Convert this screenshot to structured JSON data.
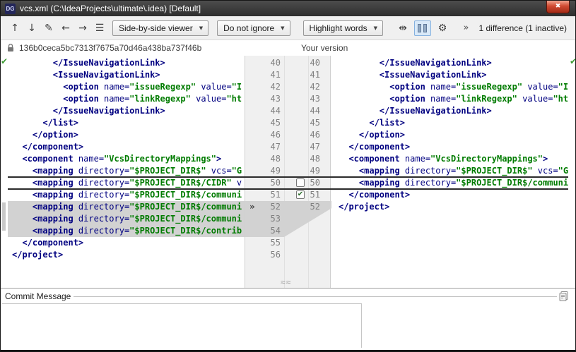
{
  "window": {
    "title": "vcs.xml (C:\\IdeaProjects\\ultimate\\.idea) [Default]",
    "app_icon_text": "DG"
  },
  "toolbar": {
    "viewer_mode": "Side-by-side viewer",
    "ignore_policy": "Do not ignore",
    "highlight_mode": "Highlight words",
    "diff_summary": "1 difference (1 inactive)"
  },
  "icons": {
    "previous": "↑",
    "next": "↓",
    "edit": "✎",
    "back": "←",
    "forward": "→",
    "menu": "☰",
    "collapse-unchanged": "⇹",
    "settings-gear": "⚙",
    "more-chevron": "»",
    "dropdown-arrow": "▼",
    "applied-check": "✔",
    "inactive-marker": "»",
    "checkbox-check": "✔",
    "close": "✖",
    "approx": "≈≈"
  },
  "header": {
    "left_revision": "136b0ceca5bc7313f7675a70d46a438ba737f46b",
    "right_label": "Your version"
  },
  "colors": {
    "tag": "#000080",
    "value": "#007b00",
    "inactive_gray": "#d2d2d2"
  },
  "commit": {
    "label": "Commit Message"
  },
  "diff": {
    "rows": [
      {
        "l": "40",
        "r": "40",
        "left": [
          [
            "t",
            "        </IssueNavigationLink>"
          ]
        ],
        "right": [
          [
            "t",
            "        </IssueNavigationLink>"
          ]
        ]
      },
      {
        "l": "41",
        "r": "41",
        "left": [
          [
            "t",
            "        <IssueNavigationLink>"
          ]
        ],
        "right": [
          [
            "t",
            "        <IssueNavigationLink>"
          ]
        ]
      },
      {
        "l": "42",
        "r": "42",
        "left": [
          [
            "t",
            "          <option "
          ],
          [
            "a",
            "name="
          ],
          [
            "v",
            "\"issueRegexp\""
          ],
          [
            "a",
            " value="
          ],
          [
            "v",
            "\"I"
          ]
        ],
        "right": [
          [
            "t",
            "          <option "
          ],
          [
            "a",
            "name="
          ],
          [
            "v",
            "\"issueRegexp\""
          ],
          [
            "a",
            " value="
          ],
          [
            "v",
            "\"IDEA"
          ]
        ]
      },
      {
        "l": "43",
        "r": "43",
        "left": [
          [
            "t",
            "          <option "
          ],
          [
            "a",
            "name="
          ],
          [
            "v",
            "\"linkRegexp\""
          ],
          [
            "a",
            " value="
          ],
          [
            "v",
            "\"ht"
          ]
        ],
        "right": [
          [
            "t",
            "          <option "
          ],
          [
            "a",
            "name="
          ],
          [
            "v",
            "\"linkRegexp\""
          ],
          [
            "a",
            " value="
          ],
          [
            "v",
            "\"https"
          ]
        ]
      },
      {
        "l": "44",
        "r": "44",
        "left": [
          [
            "t",
            "        </IssueNavigationLink>"
          ]
        ],
        "right": [
          [
            "t",
            "        </IssueNavigationLink>"
          ]
        ]
      },
      {
        "l": "45",
        "r": "45",
        "left": [
          [
            "t",
            "      </list>"
          ]
        ],
        "right": [
          [
            "t",
            "      </list>"
          ]
        ]
      },
      {
        "l": "46",
        "r": "46",
        "left": [
          [
            "t",
            "    </option>"
          ]
        ],
        "right": [
          [
            "t",
            "    </option>"
          ]
        ]
      },
      {
        "l": "47",
        "r": "47",
        "left": [
          [
            "t",
            "  </component>"
          ]
        ],
        "right": [
          [
            "t",
            "  </component>"
          ]
        ]
      },
      {
        "l": "48",
        "r": "48",
        "left": [
          [
            "t",
            "  <component "
          ],
          [
            "a",
            "name="
          ],
          [
            "v",
            "\"VcsDirectoryMappings\""
          ],
          [
            "t",
            ">"
          ]
        ],
        "right": [
          [
            "t",
            "  <component "
          ],
          [
            "a",
            "name="
          ],
          [
            "v",
            "\"VcsDirectoryMappings\""
          ],
          [
            "t",
            ">"
          ]
        ]
      },
      {
        "l": "49",
        "r": "49",
        "left": [
          [
            "t",
            "    <mapping "
          ],
          [
            "a",
            "directory="
          ],
          [
            "v",
            "\"$PROJECT_DIR$\""
          ],
          [
            "a",
            " vcs="
          ],
          [
            "v",
            "\"G"
          ]
        ],
        "right": [
          [
            "t",
            "    <mapping "
          ],
          [
            "a",
            "directory="
          ],
          [
            "v",
            "\"$PROJECT_DIR$\""
          ],
          [
            "a",
            " vcs="
          ],
          [
            "v",
            "\"Git\""
          ]
        ]
      },
      {
        "l": "50",
        "r": "50",
        "left": [
          [
            "t",
            "    <mapping "
          ],
          [
            "a",
            "directory="
          ],
          [
            "v",
            "\"$PROJECT_DIR$/CIDR\""
          ],
          [
            "a",
            " v"
          ]
        ],
        "right": [
          [
            "t",
            "    <mapping "
          ],
          [
            "a",
            "directory="
          ],
          [
            "v",
            "\"$PROJECT_DIR$/community\""
          ]
        ]
      },
      {
        "l": "51",
        "r": "51",
        "left": [
          [
            "t",
            "    <mapping "
          ],
          [
            "a",
            "directory="
          ],
          [
            "v",
            "\"$PROJECT_DIR$/communi"
          ]
        ],
        "right": [
          [
            "t",
            "  </component>"
          ]
        ]
      },
      {
        "l": "52",
        "r": "52",
        "gray": true,
        "left": [
          [
            "t",
            "    <mapping "
          ],
          [
            "a",
            "directory="
          ],
          [
            "v",
            "\"$PROJECT_DIR$/communi"
          ]
        ],
        "right": [
          [
            "t",
            "</project>"
          ]
        ]
      },
      {
        "l": "53",
        "r": "",
        "gray": true,
        "left": [
          [
            "t",
            "    <mapping "
          ],
          [
            "a",
            "directory="
          ],
          [
            "v",
            "\"$PROJECT_DIR$/communi"
          ]
        ],
        "right": []
      },
      {
        "l": "54",
        "r": "",
        "gray": true,
        "left": [
          [
            "t",
            "    <mapping "
          ],
          [
            "a",
            "directory="
          ],
          [
            "v",
            "\"$PROJECT_DIR$/contrib"
          ]
        ],
        "right": []
      },
      {
        "l": "55",
        "r": "",
        "left": [
          [
            "t",
            "  </component>"
          ]
        ],
        "right": []
      },
      {
        "l": "56",
        "r": "",
        "left": [
          [
            "t",
            "</project>"
          ]
        ],
        "right": []
      }
    ]
  }
}
